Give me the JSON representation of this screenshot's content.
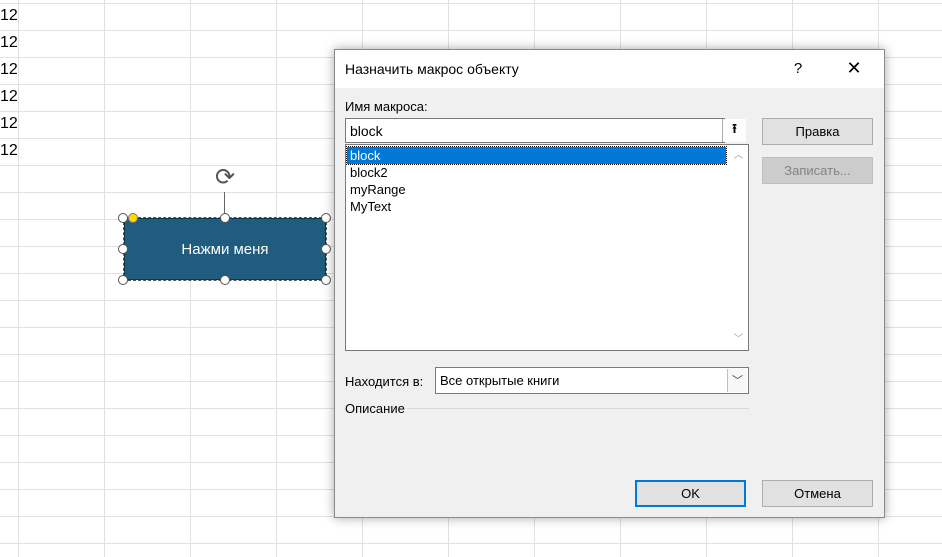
{
  "sheet": {
    "visible_values": [
      "12",
      "12",
      "12",
      "12",
      "12",
      "12"
    ]
  },
  "shape": {
    "label": "Нажми меня",
    "fill_color": "#1f5c7e"
  },
  "dialog": {
    "title": "Назначить макрос объекту",
    "help": "?",
    "close": "✕",
    "macro_name_label": "Имя макроса:",
    "macro_name_value": "block",
    "picker_icon": "upload-arrow-icon",
    "macros": [
      "block",
      "block2",
      "myRange",
      "MyText"
    ],
    "selected_macro": "block",
    "location_label": "Находится в:",
    "location_value": "Все открытые книги",
    "description_label": "Описание",
    "buttons": {
      "edit": "Правка",
      "record": "Записать...",
      "ok": "OK",
      "cancel": "Отмена"
    },
    "accent_color": "#0078d7"
  }
}
